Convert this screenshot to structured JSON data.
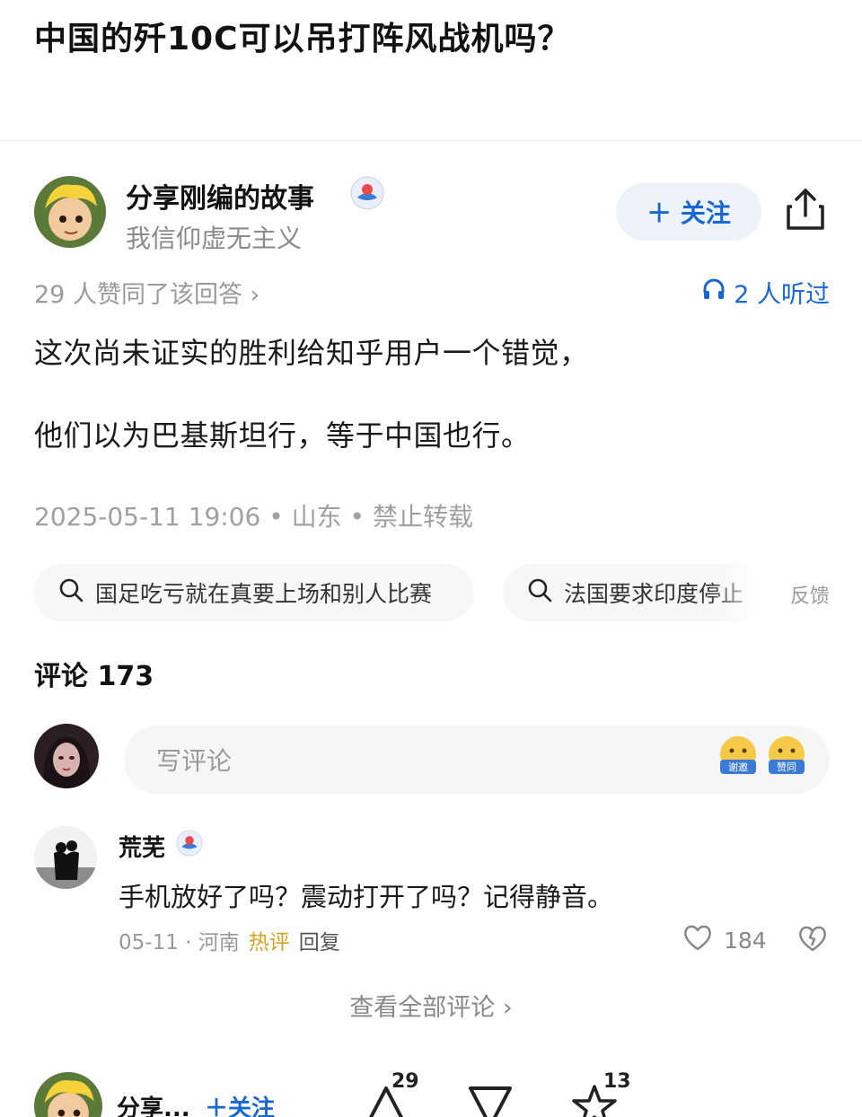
{
  "question": {
    "title": "中国的歼10C可以吊打阵风战机吗？"
  },
  "answer": {
    "author": {
      "name": "分享刚编的故事",
      "bio": "我信仰虚无主义",
      "follow_label": "＋ 关注"
    },
    "agree_text": "29 人赞同了该回答 ›",
    "listen_text": "2 人听过",
    "paragraphs": [
      "这次尚未证实的胜利给知乎用户一个错觉，",
      "他们以为巴基斯坦行，等于中国也行。"
    ],
    "meta": "2025-05-11 19:06 • 山东 • 禁止转载"
  },
  "related_searches": [
    "国足吃亏就在真要上场和别人比赛",
    "法国要求印度停止"
  ],
  "feedback_label": "反馈",
  "comments": {
    "title": "评论 173",
    "write_placeholder": "写评论",
    "emoji_labels": [
      "谢邀",
      "赞同"
    ],
    "items": [
      {
        "name": "荒芜",
        "text": "手机放好了吗？震动打开了吗？记得静音。",
        "date": "05-11 · 河南",
        "hot": "热评",
        "reply": "回复",
        "likes": "184"
      }
    ],
    "view_all": "查看全部评论 ›"
  },
  "bottom_bar": {
    "author_short": "分享...",
    "follow_label": "＋关注",
    "upvotes": "29",
    "favorites": "13"
  },
  "colors": {
    "accent": "#1967d2",
    "hot": "#d7a31c"
  }
}
